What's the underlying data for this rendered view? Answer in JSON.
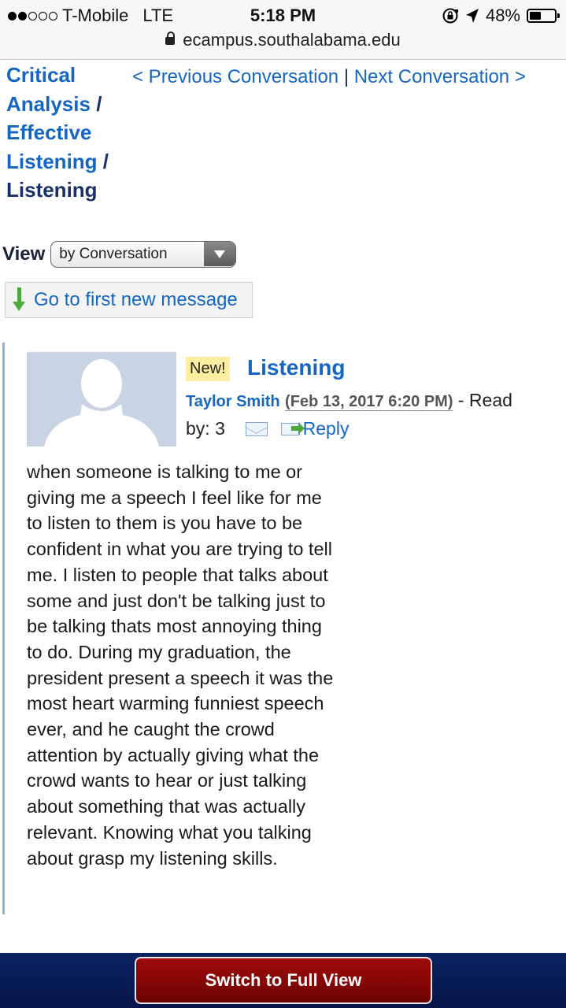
{
  "status_bar": {
    "carrier": "T-Mobile",
    "network": "LTE",
    "time": "5:18 PM",
    "battery": "48%",
    "battery_fraction": 0.48,
    "icons": [
      "signal-dots-icon",
      "rotation-lock-icon",
      "location-arrow-icon",
      "battery-icon"
    ]
  },
  "browser": {
    "url": "ecampus.southalabama.edu"
  },
  "breadcrumb": {
    "items": [
      "Critical Analysis",
      "Effective Listening",
      "Listening"
    ],
    "separator": "/"
  },
  "conversation_nav": {
    "previous": "< Previous Conversation",
    "separator": "|",
    "next": "Next Conversation >"
  },
  "view": {
    "label": "View",
    "selected": "by Conversation"
  },
  "first_new_message": {
    "label": "Go to first new message"
  },
  "post": {
    "badge": "New!",
    "title": "Listening",
    "author": "Taylor Smith",
    "date": "(Feb 13, 2017 6:20 PM)",
    "read_by_prefix": "- Read",
    "read_by_label": "by: 3",
    "reply_label": "Reply",
    "body": "when someone is talking to me or giving me a speech I feel like for me to listen to them is you have to be confident in what you are trying to tell me. I listen to people that talks about some and just don't be talking just to be talking thats most annoying thing to do. During my graduation, the president present a speech it was the most heart warming funniest speech ever, and he caught the crowd attention by actually giving what the crowd wants to hear or just talking about something that was actually relevant. Knowing what you talking about grasp my listening skills."
  },
  "footer": {
    "button_label": "Switch to Full View"
  },
  "colors": {
    "link": "#1566c2",
    "dark_text": "#1a2f66",
    "badge_bg": "#fdef9f",
    "footer_bg": "#0b2362",
    "button_bg": "#9e0b0b",
    "post_border": "#8db1d8",
    "avatar_bg": "#c8d3e3"
  }
}
